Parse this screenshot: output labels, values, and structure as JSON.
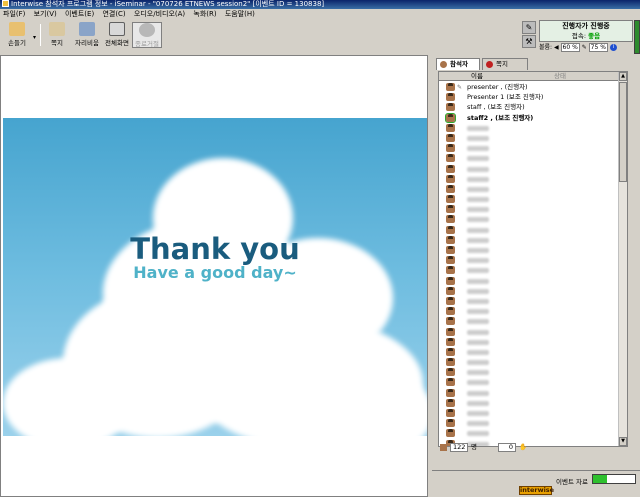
{
  "window": {
    "title": "Interwise 참석자 프로그램 정보 - iSeminar - \"070726 ETNEWS session2\" [이벤트 ID = 130838]"
  },
  "menu": [
    "파일(F)",
    "보기(V)",
    "이벤트(E)",
    "연결(C)",
    "오디오/비디오(A)",
    "녹화(R)",
    "도움말(H)"
  ],
  "toolbar": {
    "raise_hand": "손들기",
    "note": "쪽지",
    "away": "자리비움",
    "full_screen": "전체화면",
    "exit": "종료거절"
  },
  "presenter": {
    "title": "진행자가 진행중",
    "connection_label": "접속:",
    "connection_status": "좋음",
    "volume_label": "볼륨:",
    "volume_value": "60 %",
    "mic_value": "75 %"
  },
  "slide": {
    "title": "Thank you",
    "subtitle": "Have a good day~"
  },
  "participants": {
    "tab_participants": "참석자",
    "tab_notes": "쪽지",
    "col_name": "이름",
    "col_state": "상태",
    "named_rows": [
      "presenter , (진행자)",
      "Presenter 1 (보조 진행자)",
      "staff , (보조 진행자)",
      "staff2 , (보조 진행자)"
    ],
    "count": "122",
    "count_unit": "명",
    "hands": "0",
    "scroll_up_label": "▲",
    "scroll_down_label": "▼"
  },
  "status": {
    "resource_label": "이벤트 자료"
  },
  "brand": {
    "name": "interwise"
  },
  "colors": {
    "titlebar": "#0a246a",
    "thank_you": "#1a5c7e",
    "good_day": "#4fb2c8",
    "ok": "#00a000"
  },
  "icons": {
    "raise_hand": "hand-icon",
    "note": "note-icon",
    "away": "away-icon",
    "full_screen": "fullscreen-icon",
    "exit": "exit-icon"
  }
}
